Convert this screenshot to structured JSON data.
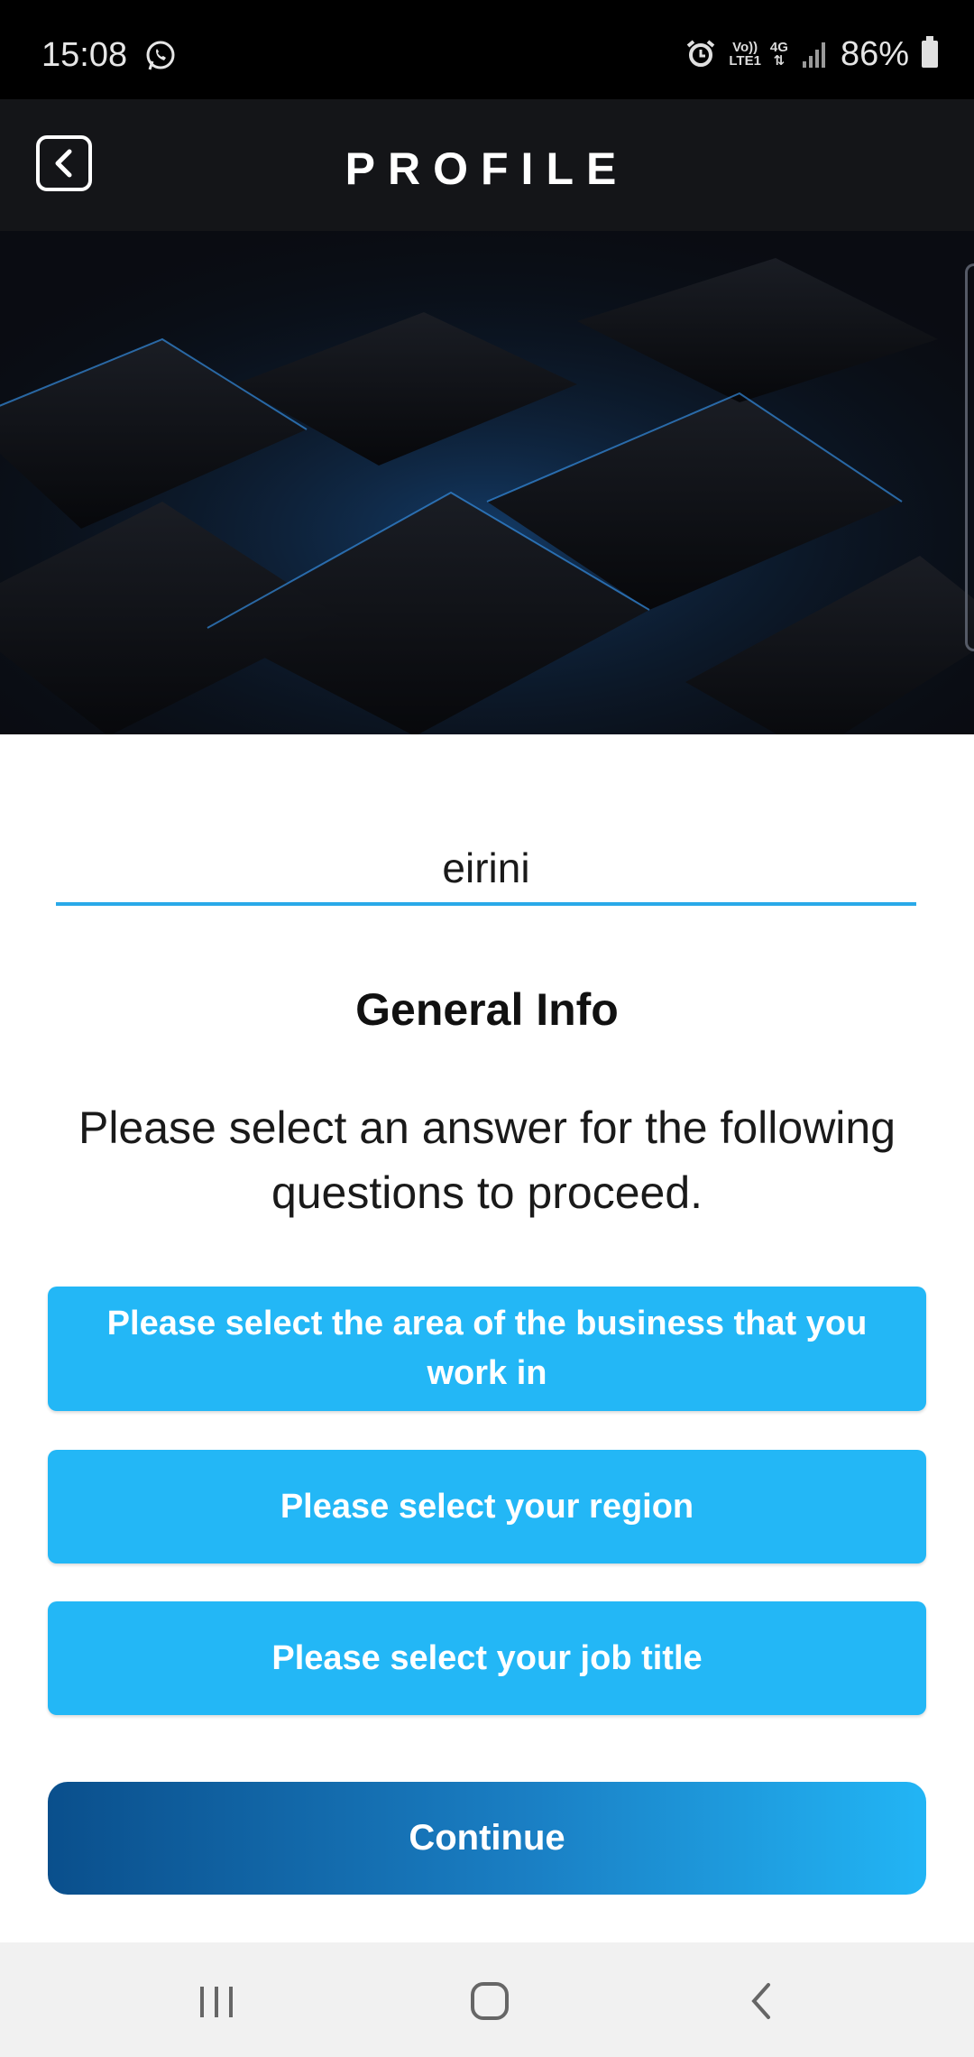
{
  "status_bar": {
    "time": "15:08",
    "network_top": "Vo))",
    "network_bottom": "LTE1",
    "data_type": "4G",
    "battery": "86%"
  },
  "header": {
    "title": "PROFILE"
  },
  "profile": {
    "username": "eirini"
  },
  "general_info": {
    "title": "General Info",
    "instructions": "Please select an answer for the following questions to proceed.",
    "area_button": "Please select the area of the business that you work in",
    "region_button": "Please select your region",
    "job_title_button": "Please select your job title",
    "continue_button": "Continue"
  },
  "colors": {
    "accent": "#23b7f6",
    "header_bg": "#141518",
    "continue_start": "#0a4f8c",
    "continue_end": "#22b5f5"
  },
  "icons": {
    "back": "back-chevron-icon",
    "whatsapp": "whatsapp-icon",
    "alarm": "alarm-icon",
    "signal": "signal-icon",
    "battery": "battery-icon"
  }
}
